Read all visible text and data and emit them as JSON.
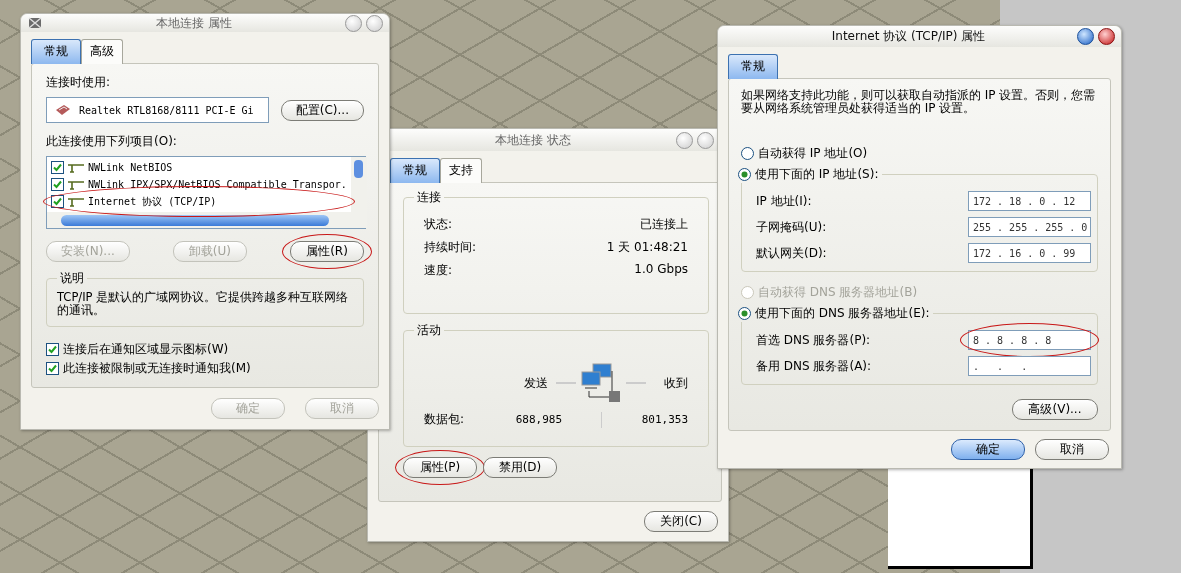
{
  "properties_dialog": {
    "title": "本地连接 属性",
    "active": false,
    "tabs": [
      {
        "label": "常规",
        "selected": true
      },
      {
        "label": "高级",
        "selected": false
      }
    ],
    "adapter_label": "连接时使用:",
    "adapter": "Realtek RTL8168/8111 PCI-E Gi",
    "configure_button": "配置(C)...",
    "items_label": "此连接使用下列项目(O):",
    "items": [
      {
        "label": "NWLink NetBIOS",
        "checked": true,
        "circled": false
      },
      {
        "label": "NWLink IPX/SPX/NetBIOS Compatible Transpor.",
        "checked": true,
        "circled": false
      },
      {
        "label": "Internet 协议 (TCP/IP)",
        "checked": true,
        "circled": true
      }
    ],
    "item_buttons": [
      {
        "label": "安装(N)...",
        "disabled": true,
        "circled": false
      },
      {
        "label": "卸载(U)",
        "disabled": true,
        "circled": false
      },
      {
        "label": "属性(R)",
        "disabled": false,
        "circled": true
      }
    ],
    "description_title": "说明",
    "description": "TCP/IP 是默认的广域网协议。它提供跨越多种互联网络的通讯。",
    "options": [
      {
        "label": "连接后在通知区域显示图标(W)",
        "checked": true
      },
      {
        "label": "此连接被限制或无连接时通知我(M)",
        "checked": true
      }
    ],
    "buttons": [
      {
        "label": "确定",
        "disabled": true,
        "default": false
      },
      {
        "label": "取消",
        "disabled": true,
        "default": false
      }
    ]
  },
  "status_dialog": {
    "title": "本地连接 状态",
    "active": false,
    "tabs": [
      {
        "label": "常规",
        "selected": true
      },
      {
        "label": "支持",
        "selected": false
      }
    ],
    "connection_title": "连接",
    "connection_rows": [
      {
        "label": "状态:",
        "value": "已连接上"
      },
      {
        "label": "持续时间:",
        "value": "1 天 01:48:21"
      },
      {
        "label": "速度:",
        "value": "1.0 Gbps"
      }
    ],
    "activity_title": "活动",
    "sent_label": "发送",
    "received_label": "收到",
    "packets_label": "数据包:",
    "packets_sent": "688,985",
    "packets_received": "801,353",
    "action_buttons": [
      {
        "label": "属性(P)",
        "disabled": false,
        "circled": true
      },
      {
        "label": "禁用(D)",
        "disabled": false,
        "circled": false
      }
    ],
    "close_button": "关闭(C)"
  },
  "tcpip_dialog": {
    "title": "Internet 协议 (TCP/IP) 属性",
    "active": true,
    "tabs": [
      {
        "label": "常规",
        "selected": true
      }
    ],
    "description": "如果网络支持此功能，则可以获取自动指派的 IP 设置。否则，您需要从网络系统管理员处获得适当的 IP 设置。",
    "ip_auto": {
      "label": "自动获得 IP 地址(O)",
      "selected": false,
      "disabled": false
    },
    "ip_manual": {
      "label": "使用下面的 IP 地址(S):",
      "selected": true,
      "disabled": false
    },
    "ip_fields": [
      {
        "label": "IP 地址(I):",
        "value": "172 . 18 . 0 . 12",
        "circled": false
      },
      {
        "label": "子网掩码(U):",
        "value": "255 . 255 . 255 . 0",
        "circled": false
      },
      {
        "label": "默认网关(D):",
        "value": "172 . 16 . 0 . 99",
        "circled": false
      }
    ],
    "dns_auto": {
      "label": "自动获得 DNS 服务器地址(B)",
      "selected": false,
      "disabled": true
    },
    "dns_manual": {
      "label": "使用下面的 DNS 服务器地址(E):",
      "selected": true,
      "disabled": false
    },
    "dns_fields": [
      {
        "label": "首选 DNS 服务器(P):",
        "value": "8 . 8 . 8 . 8",
        "circled": true
      },
      {
        "label": "备用 DNS 服务器(A):",
        "value": ".   .   .",
        "circled": false
      }
    ],
    "advanced_button": "高级(V)...",
    "buttons": [
      {
        "label": "确定",
        "disabled": false,
        "default": true
      },
      {
        "label": "取消",
        "disabled": false,
        "default": false
      }
    ]
  }
}
